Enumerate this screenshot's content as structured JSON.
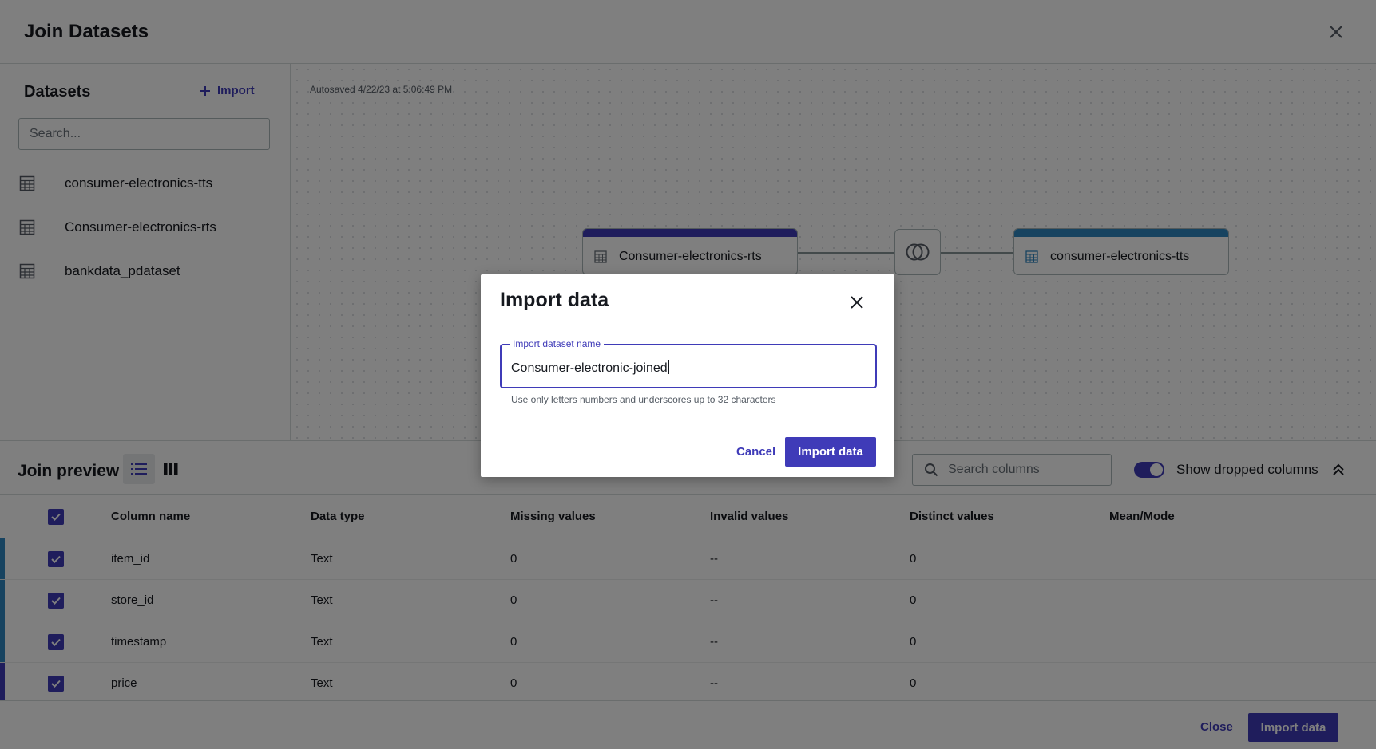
{
  "header": {
    "title": "Join Datasets",
    "close_icon": "close-icon"
  },
  "sidebar": {
    "title": "Datasets",
    "import_label": "Import",
    "search_placeholder": "Search...",
    "items": [
      {
        "label": "consumer-electronics-tts",
        "icon": "table-icon"
      },
      {
        "label": "Consumer-electronics-rts",
        "icon": "table-icon"
      },
      {
        "label": "bankdata_pdataset",
        "icon": "table-icon"
      }
    ]
  },
  "canvas": {
    "autosave": "Autosaved 4/22/23 at 5:06:49 PM",
    "left_node": {
      "label": "Consumer-electronics-rts",
      "color": "#3f3bb8"
    },
    "right_node": {
      "label": "consumer-electronics-tts",
      "color": "#2e86c1"
    },
    "join_icon": "inner-join-icon"
  },
  "preview": {
    "title": "Join preview",
    "search_placeholder": "Search columns",
    "toggle_label": "Show dropped columns",
    "toggle_on": true,
    "columns": [
      "Column name",
      "Data type",
      "Missing values",
      "Invalid values",
      "Distinct values",
      "Mean/Mode"
    ],
    "rows": [
      {
        "name": "item_id",
        "type": "Text",
        "missing": "0",
        "invalid": "--",
        "distinct": "0",
        "mean": "",
        "source_color": "#2e86c1"
      },
      {
        "name": "store_id",
        "type": "Text",
        "missing": "0",
        "invalid": "--",
        "distinct": "0",
        "mean": "",
        "source_color": "#2e86c1"
      },
      {
        "name": "timestamp",
        "type": "Text",
        "missing": "0",
        "invalid": "--",
        "distinct": "0",
        "mean": "",
        "source_color": "#2e86c1"
      },
      {
        "name": "price",
        "type": "Text",
        "missing": "0",
        "invalid": "--",
        "distinct": "0",
        "mean": "",
        "source_color": "#3f3bb8"
      }
    ]
  },
  "footer": {
    "close_label": "Close",
    "primary_label": "Import data"
  },
  "modal": {
    "title": "Import data",
    "field_label": "Import dataset name",
    "field_value": "Consumer-electronic-joined",
    "hint": "Use only letters numbers and underscores up to 32 characters",
    "cancel_label": "Cancel",
    "primary_label": "Import data"
  },
  "colors": {
    "accent": "#3f3bb8",
    "secondary": "#2e86c1",
    "overlay": "rgba(0,0,0,0.5)"
  }
}
